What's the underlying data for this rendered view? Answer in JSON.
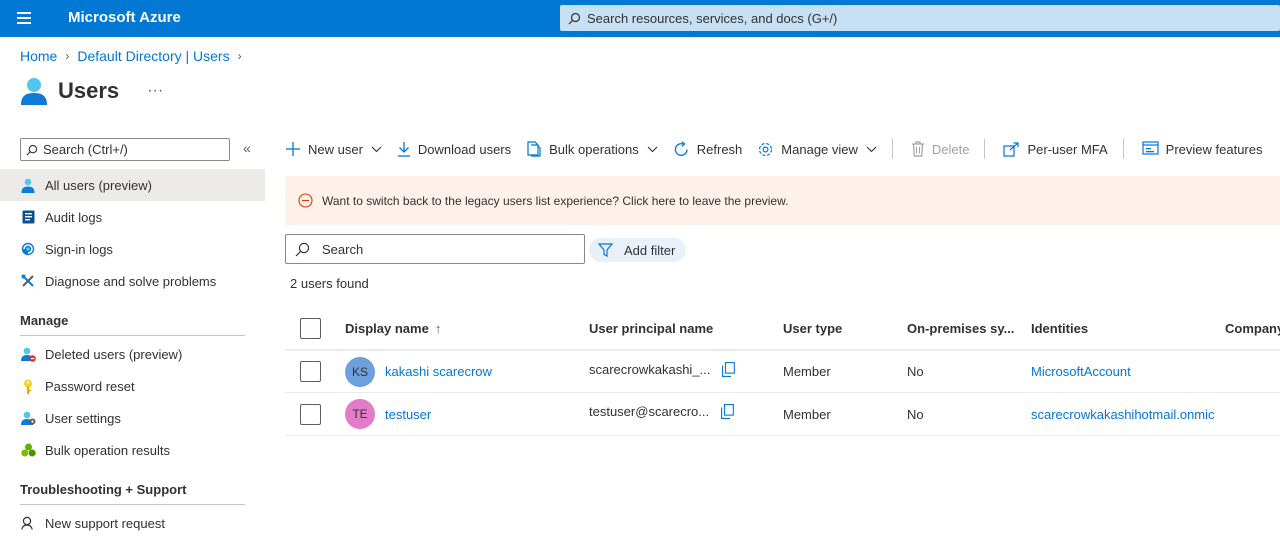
{
  "topbar": {
    "brand": "Microsoft Azure",
    "search_placeholder": "Search resources, services, and docs (G+/)"
  },
  "breadcrumb": {
    "home": "Home",
    "directory": "Default Directory | Users"
  },
  "page": {
    "title": "Users",
    "more": "···"
  },
  "sidebar": {
    "search_placeholder": "Search (Ctrl+/)",
    "collapse": "«",
    "items": [
      {
        "label": "All users (preview)",
        "icon": "user-icon"
      },
      {
        "label": "Audit logs",
        "icon": "audit-logs-icon"
      },
      {
        "label": "Sign-in logs",
        "icon": "sign-in-logs-icon"
      },
      {
        "label": "Diagnose and solve problems",
        "icon": "wrench-icon"
      }
    ],
    "manage_heading": "Manage",
    "manage_items": [
      {
        "label": "Deleted users (preview)",
        "icon": "deleted-user-icon"
      },
      {
        "label": "Password reset",
        "icon": "key-icon"
      },
      {
        "label": "User settings",
        "icon": "user-settings-icon"
      },
      {
        "label": "Bulk operation results",
        "icon": "bulk-results-icon"
      }
    ],
    "support_heading": "Troubleshooting + Support",
    "support_items": [
      {
        "label": "New support request",
        "icon": "support-icon"
      }
    ]
  },
  "toolbar": {
    "new_user": "New user",
    "download_users": "Download users",
    "bulk_operations": "Bulk operations",
    "refresh": "Refresh",
    "manage_view": "Manage view",
    "delete": "Delete",
    "per_user_mfa": "Per-user MFA",
    "preview_features": "Preview features"
  },
  "banner": {
    "text": "Want to switch back to the legacy users list experience? Click here to leave the preview."
  },
  "list": {
    "search_placeholder": "Search",
    "add_filter": "Add filter",
    "found": "2 users found"
  },
  "table": {
    "columns": [
      "Display name",
      "User principal name",
      "User type",
      "On-premises sy...",
      "Identities",
      "Company"
    ],
    "sort_indicator": "↑",
    "rows": [
      {
        "initials": "KS",
        "avatar_color": "#6ea1dc",
        "display_name": "kakashi scarecrow",
        "upn": "scarecrowkakashi_...",
        "user_type": "Member",
        "on_prem": "No",
        "identities": "MicrosoftAccount"
      },
      {
        "initials": "TE",
        "avatar_color": "#e37cc6",
        "display_name": "testuser",
        "upn": "testuser@scarecro...",
        "user_type": "Member",
        "on_prem": "No",
        "identities": "scarecrowkakashihotmail.onmic"
      }
    ]
  },
  "colors": {
    "accent": "#0078d4",
    "banner_bg": "#fdf1e9",
    "active_nav": "#edebe9"
  }
}
